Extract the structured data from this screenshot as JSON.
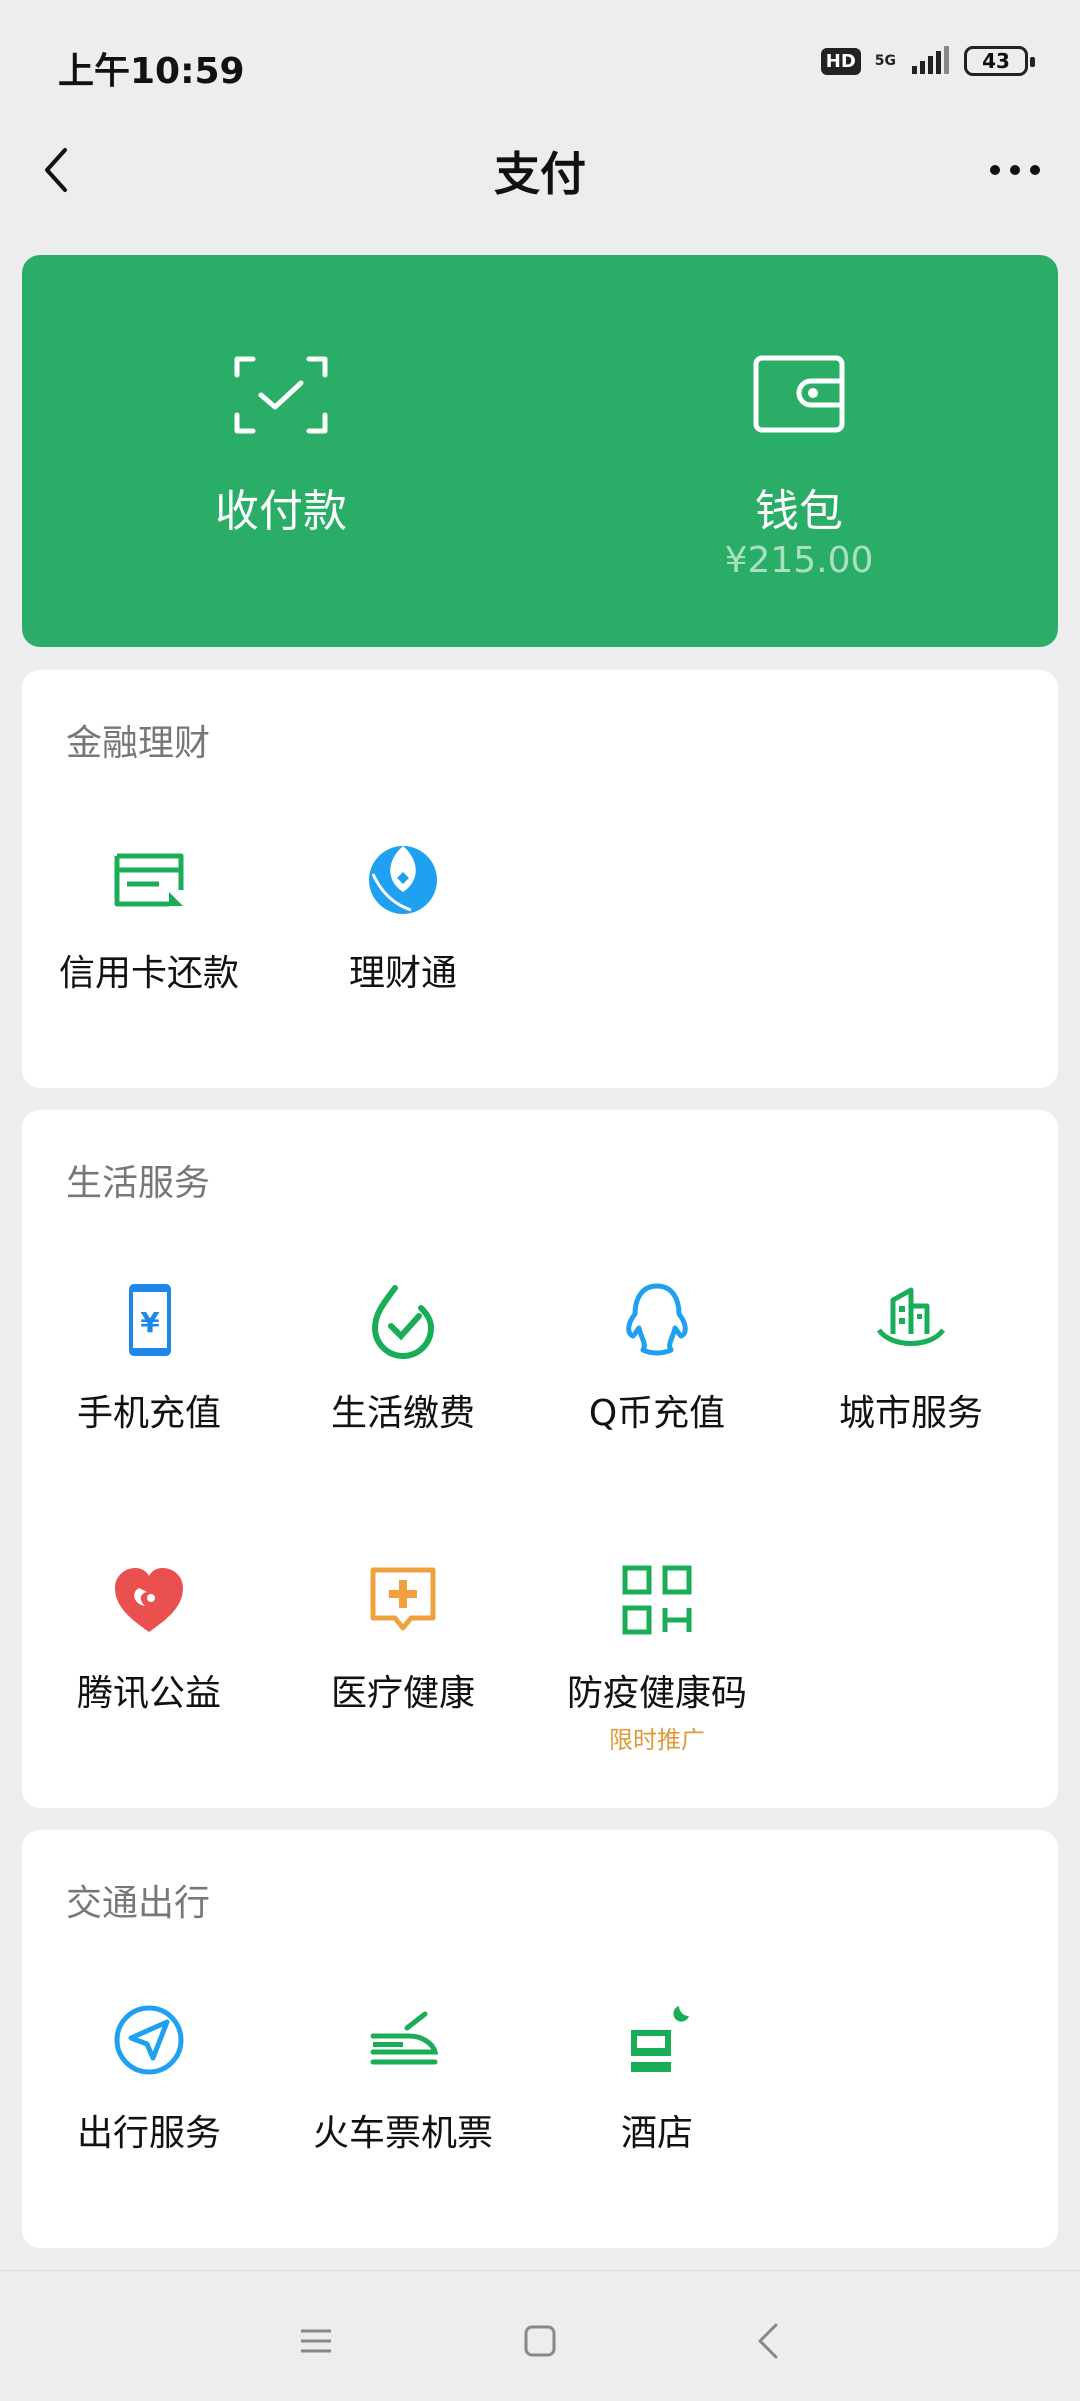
{
  "status": {
    "time": "上午10:59",
    "hd": "HD",
    "net": "5G",
    "battery": "43"
  },
  "nav": {
    "title": "支付"
  },
  "hero": {
    "pay_label": "收付款",
    "wallet_label": "钱包",
    "wallet_balance": "¥215.00"
  },
  "finance": {
    "title": "金融理财",
    "items": [
      {
        "label": "信用卡还款",
        "icon": "credit-card-icon"
      },
      {
        "label": "理财通",
        "icon": "wealth-icon"
      }
    ]
  },
  "life": {
    "title": "生活服务",
    "items": [
      {
        "label": "手机充值",
        "icon": "phone-recharge-icon"
      },
      {
        "label": "生活缴费",
        "icon": "utility-bill-icon"
      },
      {
        "label": "Q币充值",
        "icon": "qq-coin-icon"
      },
      {
        "label": "城市服务",
        "icon": "city-service-icon"
      },
      {
        "label": "腾讯公益",
        "icon": "charity-heart-icon"
      },
      {
        "label": "医疗健康",
        "icon": "medical-icon"
      },
      {
        "label": "防疫健康码",
        "icon": "qr-code-icon",
        "tag": "限时推广"
      }
    ]
  },
  "transport": {
    "title": "交通出行",
    "items": [
      {
        "label": "出行服务",
        "icon": "navigation-icon"
      },
      {
        "label": "火车票机票",
        "icon": "train-icon"
      },
      {
        "label": "酒店",
        "icon": "hotel-icon"
      }
    ]
  },
  "colors": {
    "green": "#2aae67",
    "blue": "#1fa0f0",
    "orange": "#f0a03c",
    "red": "#ea5050"
  }
}
